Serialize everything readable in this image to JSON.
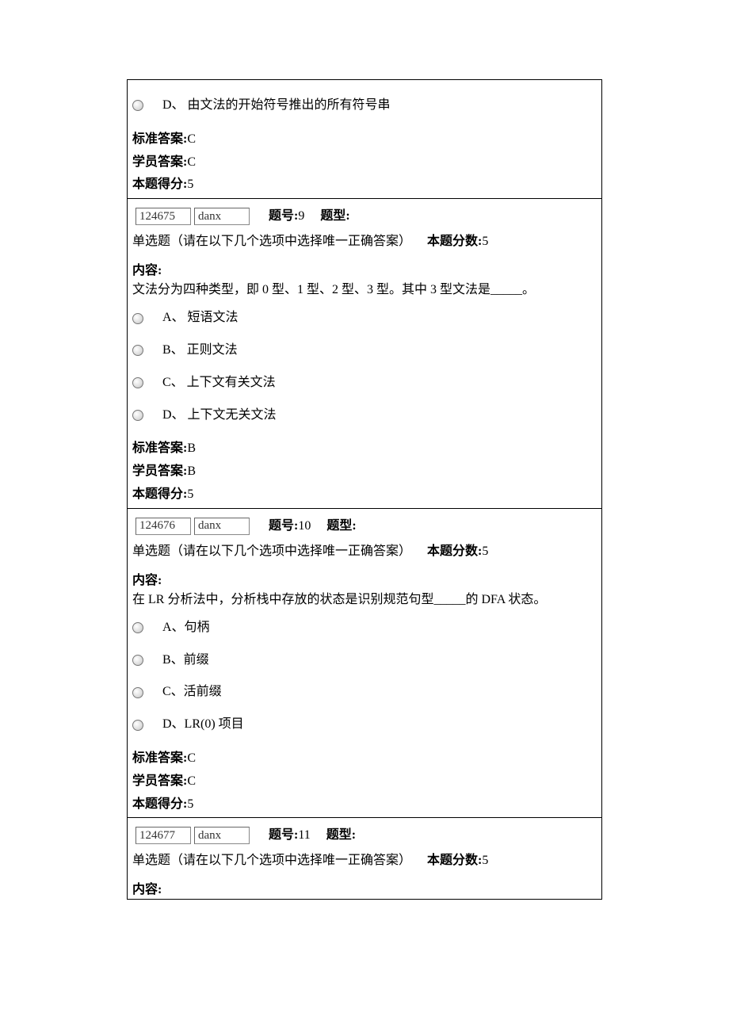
{
  "labels": {
    "question_no": "题号:",
    "question_type": "题型:",
    "type_desc": "单选题（请在以下几个选项中选择唯一正确答案）",
    "score_label": "本题分数:",
    "content_label": "内容:",
    "std_answer": "标准答案:",
    "stu_answer": "学员答案:",
    "got_score": "本题得分:"
  },
  "q8_tail": {
    "option_d": "D、  由文法的开始符号推出的所有符号串",
    "std": "C",
    "stu": "C",
    "got": "5"
  },
  "q9": {
    "id": "124675",
    "qtype": "danx",
    "number": "9",
    "score": "5",
    "content": "文法分为四种类型，即 0 型、1 型、2 型、3 型。其中 3 型文法是_____。",
    "options": {
      "a": "A、 短语文法",
      "b": "B、  正则文法",
      "c": "C、  上下文有关文法",
      "d": "D、  上下文无关文法"
    },
    "std": "B",
    "stu": "B",
    "got": "5"
  },
  "q10": {
    "id": "124676",
    "qtype": "danx",
    "number": "10",
    "score": "5",
    "content": "在 LR 分析法中，分析栈中存放的状态是识别规范句型_____的 DFA 状态。",
    "options": {
      "a": "A、句柄",
      "b": "B、前缀",
      "c": "C、活前缀",
      "d": "D、LR(0) 项目"
    },
    "std": "C",
    "stu": "C",
    "got": "5"
  },
  "q11": {
    "id": "124677",
    "qtype": "danx",
    "number": "11",
    "score": "5"
  }
}
